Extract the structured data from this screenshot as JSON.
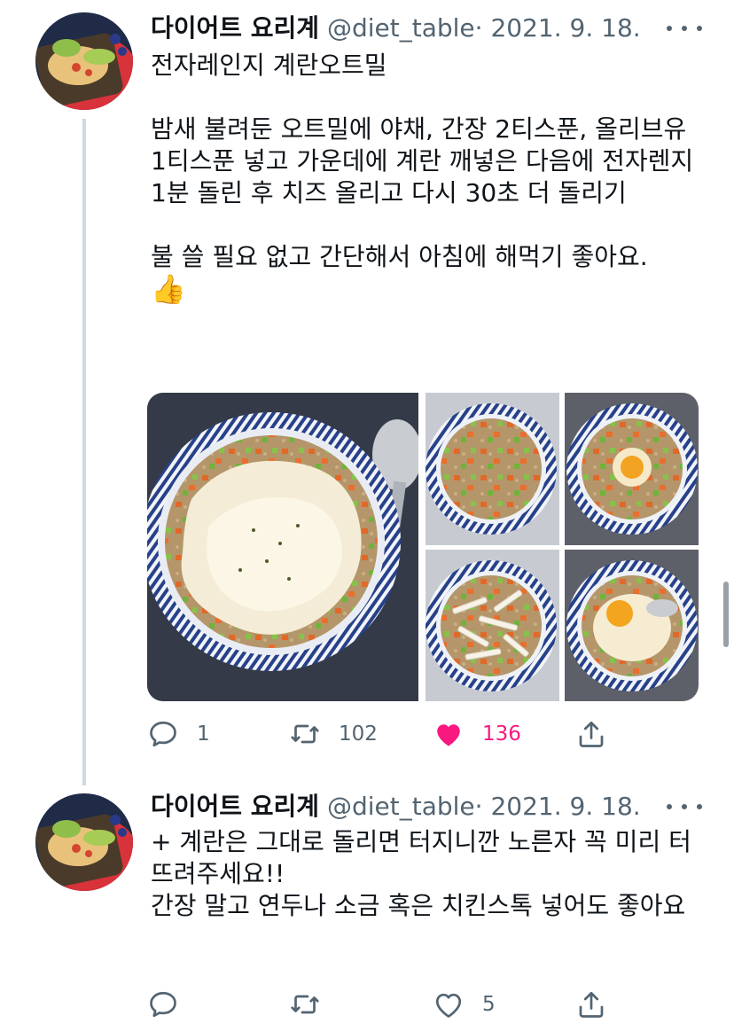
{
  "tweets": [
    {
      "author_name": "다이어트 요리계",
      "handle": "@diet_table",
      "separator": "·",
      "date": "2021. 9. 18.",
      "text": "전자레인지 계란오트밀\n\n밤새 불려둔 오트밀에 야채, 간장 2티스푼, 올리브유 1티스푼 넣고 가운데에 계란 깨넣은 다음에 전자렌지 1분 돌린 후 치즈 올리고 다시 30초 더 돌리기\n\n불 쓸 필요 없고 간단해서 아침에 해먹기 좋아요.",
      "emoji": "👍",
      "replies": "1",
      "retweets": "102",
      "likes": "136",
      "liked": true
    },
    {
      "author_name": "다이어트 요리계",
      "handle": "@diet_table",
      "separator": "·",
      "date": "2021. 9. 18.",
      "text": "+ 계란은 그대로 돌리면 터지니깐 노른자 꼭 미리 터뜨려주세요!!\n간장 말고 연두나 소금 혹은 치킨스톡 넣어도 좋아요",
      "replies": "",
      "retweets": "",
      "likes": "5",
      "liked": false
    }
  ],
  "icons": {
    "reply": "reply-icon",
    "retweet": "retweet-icon",
    "like": "heart-icon",
    "share": "share-icon",
    "more": "more-icon"
  },
  "colors": {
    "text": "#0f1419",
    "secondary": "#536471",
    "like": "#f91880",
    "thread_line": "#cfd9de"
  }
}
